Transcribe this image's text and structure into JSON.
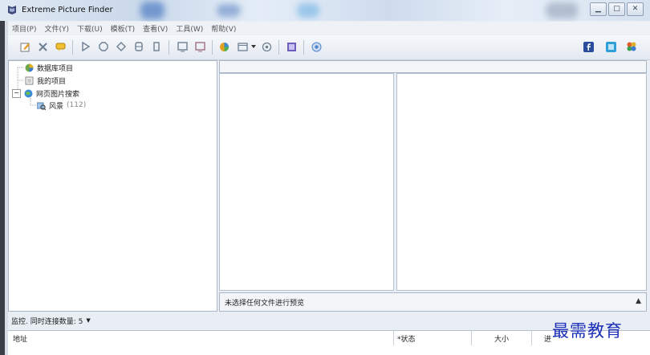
{
  "window": {
    "title": "Extreme Picture Finder"
  },
  "menu": [
    "项目(P)",
    "文件(Y)",
    "下载(U)",
    "模板(T)",
    "查看(V)",
    "工具(W)",
    "帮助(V)"
  ],
  "tree": {
    "items": [
      {
        "label": "数据库项目",
        "icon": "database-icon"
      },
      {
        "label": "我的项目",
        "icon": "folder-icon"
      },
      {
        "label": "网页图片搜索",
        "icon": "globe-icon"
      },
      {
        "label": "风景",
        "count": "(112)",
        "icon": "search-image-icon"
      }
    ]
  },
  "preview": {
    "text": "未选择任何文件进行预览"
  },
  "monitor": {
    "label": "监控. 同时连接数量: 5"
  },
  "table": {
    "columns": [
      "地址",
      "*状态",
      "大小",
      "进"
    ]
  },
  "watermark": "最需教育"
}
